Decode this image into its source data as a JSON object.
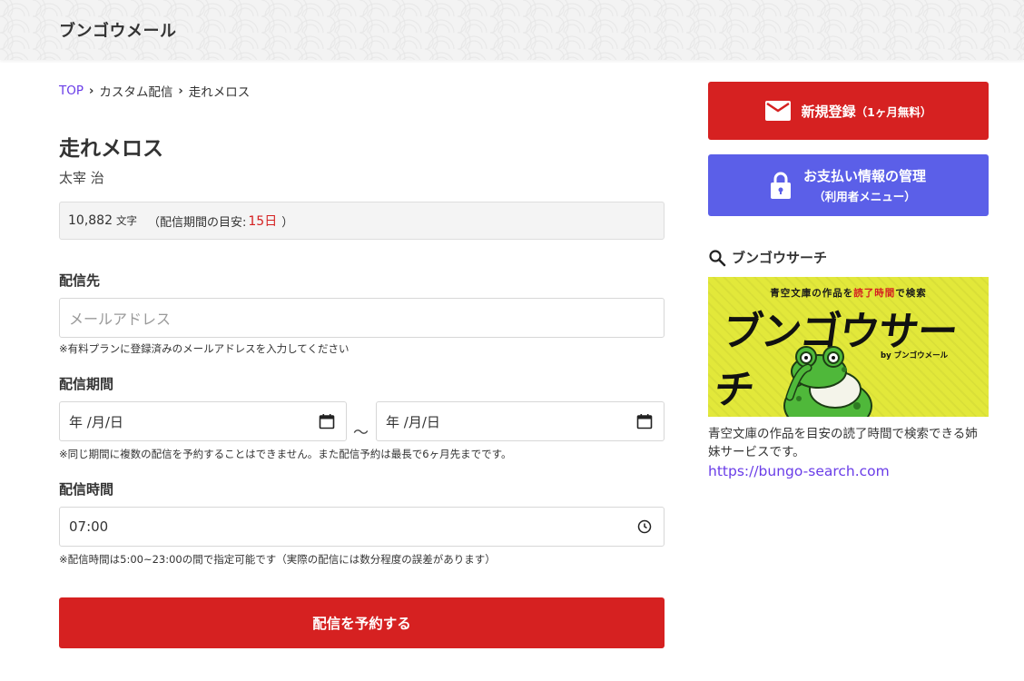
{
  "header": {
    "logo": "ブンゴウメール"
  },
  "breadcrumb": {
    "top": "TOP",
    "custom": "カスタム配信",
    "current": "走れメロス"
  },
  "work": {
    "title": "走れメロス",
    "author": "太宰 治",
    "chars": "10,882",
    "chars_unit": "文字",
    "period_prefix": "（配信期間の目安:",
    "period_days": "15日",
    "period_suffix": "）"
  },
  "form": {
    "destination_label": "配信先",
    "email_placeholder": "メールアドレス",
    "email_note": "※有料プランに登録済みのメールアドレスを入力してください",
    "period_label": "配信期間",
    "start_date": "年 /月/日",
    "tilde": "〜",
    "end_date": "年 /月/日",
    "period_note": "※同じ期間に複数の配信を予約することはできません。また配信予約は最長で6ヶ月先までです。",
    "time_label": "配信時間",
    "time_value": "07:00",
    "time_note": "※配信時間は5:00~23:00の間で指定可能です（実際の配信には数分程度の誤差があります）",
    "submit_label": "配信を予約する"
  },
  "sidebar": {
    "register_label": "新規登録",
    "register_sub": "（1ヶ月無料）",
    "payment_label": "お支払い情報の管理",
    "payment_sub": "（利用者メニュー）",
    "search_heading": "ブンゴウサーチ",
    "banner_tagline_a": "青空文庫の作品を",
    "banner_tagline_b": "読了時間",
    "banner_tagline_c": "で検索",
    "banner_title": "ブンゴウサーチ",
    "banner_by": "by ブンゴウメール",
    "description": "青空文庫の作品を目安の読了時間で検索できる姉妹サービスです。",
    "link": "https://bungo-search.com"
  },
  "colors": {
    "primary_red": "#d62121",
    "payment_blue": "#5b5fe8",
    "link_purple": "#6a3de8",
    "banner_yellow": "#e2e83a"
  }
}
